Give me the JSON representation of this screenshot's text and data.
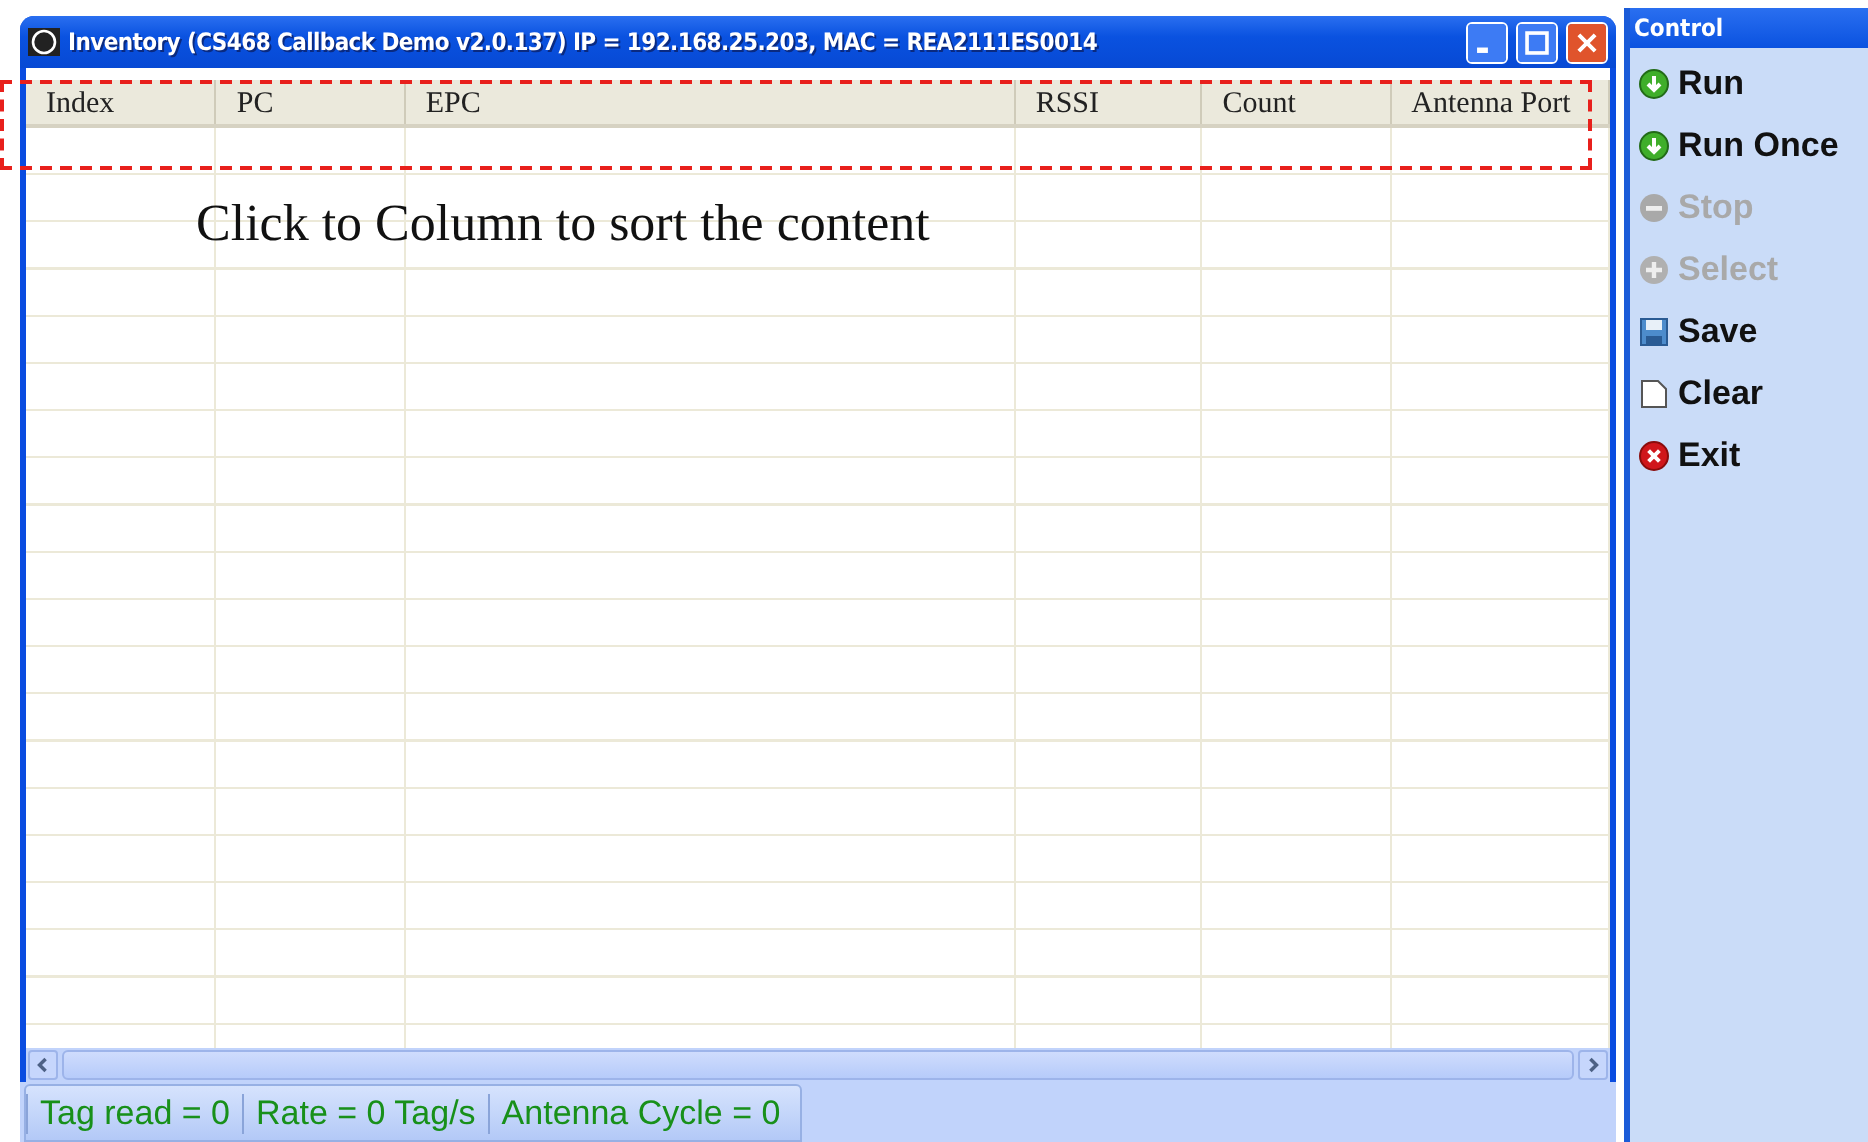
{
  "window": {
    "title": "Inventory (CS468 Callback Demo v2.0.137) IP = 192.168.25.203, MAC = REA2111ES0014"
  },
  "table": {
    "columns": [
      "Index",
      "PC",
      "EPC",
      "RSSI",
      "Count",
      "Antenna Port"
    ]
  },
  "annotation": {
    "text": "Click to Column to sort the content"
  },
  "status_bar": [
    "Tag read = 0",
    "Rate = 0 Tag/s",
    "Antenna Cycle = 0"
  ],
  "control_panel": {
    "title": "Control",
    "items": [
      {
        "label": "Run",
        "kind": "run",
        "disabled": false
      },
      {
        "label": "Run Once",
        "kind": "run",
        "disabled": false
      },
      {
        "label": "Stop",
        "kind": "stop",
        "disabled": true
      },
      {
        "label": "Select",
        "kind": "select",
        "disabled": true
      },
      {
        "label": "Save",
        "kind": "save",
        "disabled": false
      },
      {
        "label": "Clear",
        "kind": "clear",
        "disabled": false
      },
      {
        "label": "Exit",
        "kind": "exit",
        "disabled": false
      }
    ]
  }
}
